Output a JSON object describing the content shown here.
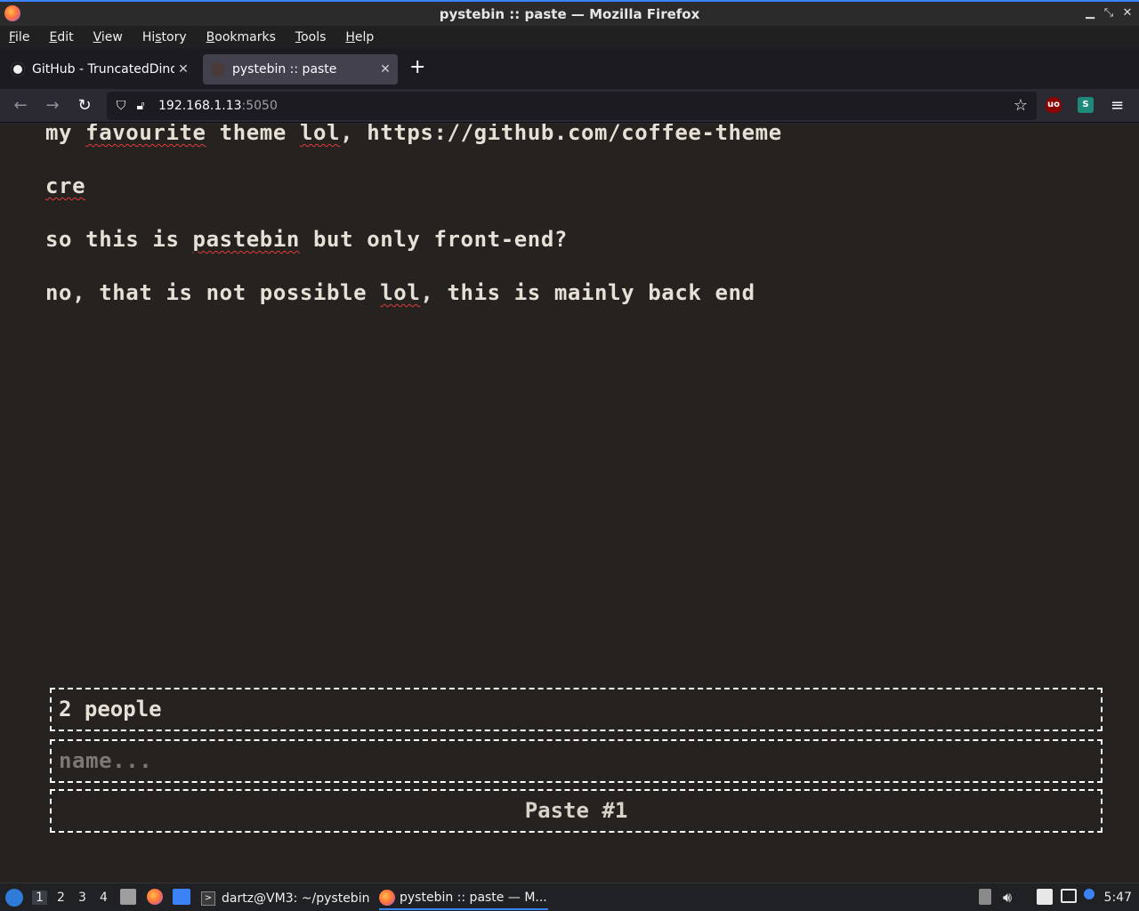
{
  "window": {
    "title": "pystebin :: paste — Mozilla Firefox"
  },
  "menu": {
    "items": [
      {
        "label": "File",
        "u": "F",
        "rest": "ile"
      },
      {
        "label": "Edit",
        "u": "E",
        "rest": "dit"
      },
      {
        "label": "View",
        "u": "V",
        "rest": "iew"
      },
      {
        "label": "History",
        "u": "s",
        "pre": "Hi",
        "rest": "tory"
      },
      {
        "label": "Bookmarks",
        "u": "B",
        "rest": "ookmarks"
      },
      {
        "label": "Tools",
        "u": "T",
        "rest": "ools"
      },
      {
        "label": "Help",
        "u": "H",
        "rest": "elp"
      }
    ]
  },
  "tabs": [
    {
      "label": "GitHub - TruncatedDinosour",
      "close": "✕"
    },
    {
      "label": "pystebin :: paste",
      "close": "✕"
    }
  ],
  "newtab_glyph": "+",
  "nav": {
    "back": "←",
    "forward": "→",
    "reload": "↻",
    "url_host": "192.168.1.13",
    "url_port": ":5050",
    "star": "☆",
    "ext1": "uo",
    "ext2": "S",
    "menu": "≡"
  },
  "messages": [
    {
      "pre": "my ",
      "err1": "favourite",
      "mid": " theme ",
      "err2": "lol",
      "post": ", https://github.com/coffee-theme"
    },
    {
      "pre": "",
      "err1": "cre",
      "mid": "",
      "err2": "",
      "post": ""
    },
    {
      "pre": "so this is ",
      "err1": "pastebin",
      "mid": " but only front-end?",
      "err2": "",
      "post": ""
    },
    {
      "pre": "no, that is not possible ",
      "err1": "lol",
      "mid": ", this is mainly back end",
      "err2": "",
      "post": ""
    }
  ],
  "people_count": "2 people",
  "name_placeholder": "name...",
  "paste_button": "Paste #1",
  "taskbar": {
    "workspaces": [
      "1",
      "2",
      "3",
      "4"
    ],
    "terminal_task": "dartz@VM3: ~/pystebin",
    "firefox_task": "pystebin :: paste — M...",
    "clock": "5:47"
  },
  "colors": {
    "page_bg": "#252220",
    "text": "#e6e0d6",
    "accent": "#3b82f6",
    "spell_error": "#e23b3b"
  }
}
